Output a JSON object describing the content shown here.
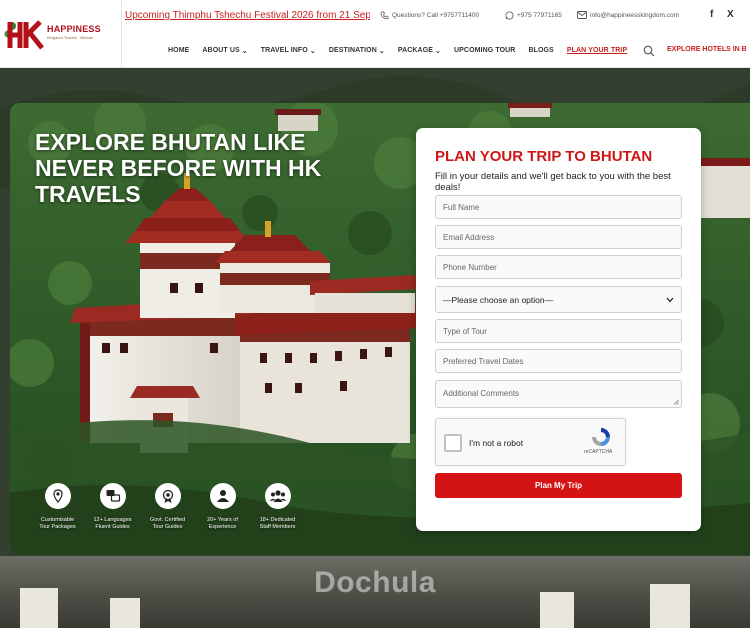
{
  "brand": {
    "logo_mark": "HK",
    "name": "HAPPINESS",
    "tagline": "Kingdom Travels · Bhutan",
    "accent": "#c8211e"
  },
  "topbar": {
    "ticker": "Upcoming Thimphu Tshechu Festival 2026 from 21 Sep",
    "questions": "Questions? Call +9757711400",
    "whatsapp": "+975 77971165",
    "email": "info@happineesskingdom.com",
    "social": [
      "f",
      "X"
    ]
  },
  "nav": {
    "items": [
      {
        "label": "HOME",
        "dropdown": false
      },
      {
        "label": "ABOUT US",
        "dropdown": true
      },
      {
        "label": "TRAVEL INFO",
        "dropdown": true
      },
      {
        "label": "DESTINATION",
        "dropdown": true
      },
      {
        "label": "PACKAGE",
        "dropdown": true
      },
      {
        "label": "UPCOMING TOUR",
        "dropdown": false
      },
      {
        "label": "BLOGS",
        "dropdown": false
      },
      {
        "label": "PLAN YOUR TRIP",
        "dropdown": false,
        "active": true
      }
    ],
    "search_icon": "search-icon",
    "hotels_link": "EXPLORE HOTELS IN B"
  },
  "hero": {
    "title": "EXPLORE BHUTAN LIKE NEVER BEFORE WITH HK TRAVELS",
    "features": [
      {
        "icon": "map-pin-icon",
        "line1": "Customisable",
        "line2": "Tour Packages"
      },
      {
        "icon": "language-icon",
        "line1": "12+ Languages",
        "line2": "Fluent Guides"
      },
      {
        "icon": "certified-badge-icon",
        "line1": "Govt. Certified",
        "line2": "Tour Guides"
      },
      {
        "icon": "experience-icon",
        "line1": "20+ Years of",
        "line2": "Experience"
      },
      {
        "icon": "team-icon",
        "line1": "18+ Dedicated",
        "line2": "Staff Members"
      }
    ]
  },
  "form": {
    "title": "PLAN YOUR TRIP TO BHUTAN",
    "subtitle": "Fill in your details and we'll get back to you with the best deals!",
    "full_name": "Full Name",
    "email": "Email Address",
    "phone": "Phone Number",
    "select_option": "—Please choose an option—",
    "tour_type": "Type of Tour",
    "dates": "Preferred Travel Dates",
    "comments": "Additional Comments",
    "captcha_label": "I'm not a robot",
    "captcha_brand": "reCAPTCHA",
    "submit": "Plan My Trip"
  },
  "section": {
    "next_title": "Dochula"
  },
  "colors": {
    "primary_red": "#d41414",
    "text_dark": "#222222"
  }
}
